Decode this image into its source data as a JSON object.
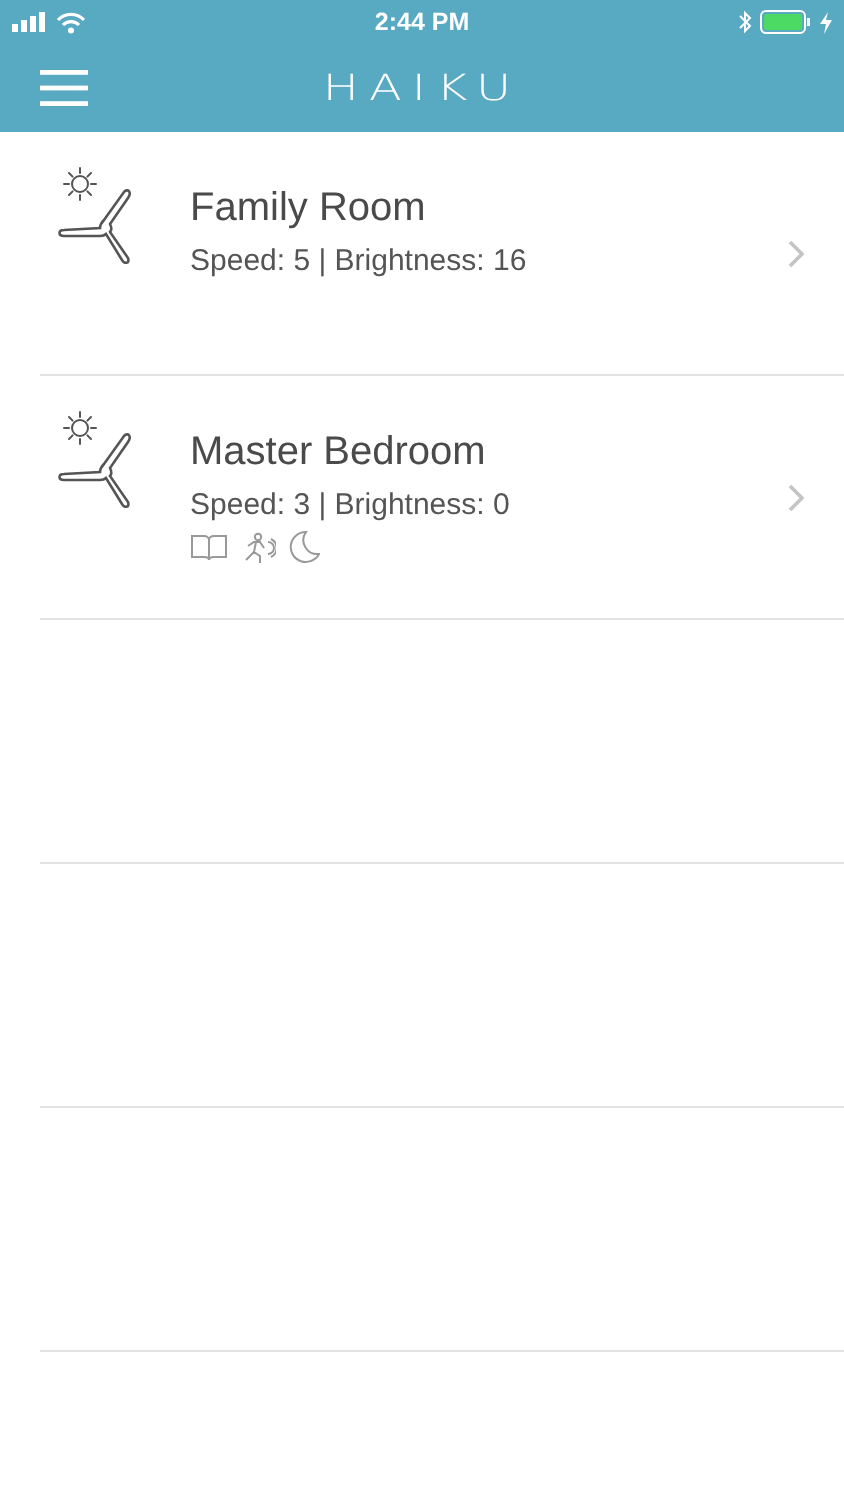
{
  "status_bar": {
    "time": "2:44 PM"
  },
  "nav": {
    "logo": "HAIKU"
  },
  "devices": [
    {
      "name": "Family Room",
      "status": "Speed: 5 | Brightness: 16"
    },
    {
      "name": "Master Bedroom",
      "status": "Speed: 3 | Brightness: 0",
      "modes": [
        {
          "kind": "book"
        },
        {
          "kind": "motion"
        },
        {
          "kind": "moon"
        }
      ]
    }
  ]
}
